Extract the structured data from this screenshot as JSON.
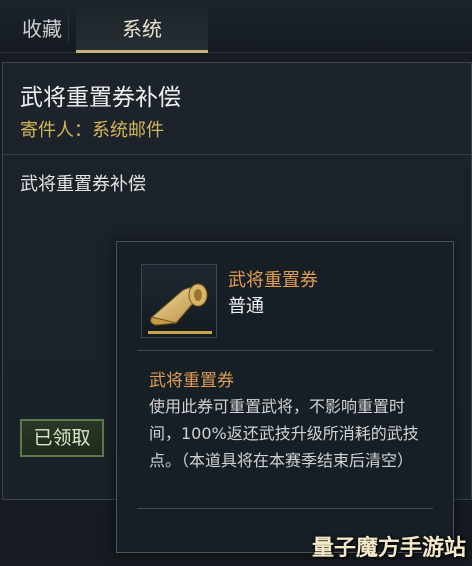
{
  "tabs": {
    "left_partial": "收藏",
    "active": "系统"
  },
  "mail": {
    "title": "武将重置券补偿",
    "sender": "寄件人：系统邮件",
    "body": "武将重置券补偿",
    "claimed_button": "已领取"
  },
  "tooltip": {
    "item_name": "武将重置券",
    "rarity": "普通",
    "desc_title": "武将重置券",
    "desc_text": "使用此券可重置武将，不影响重置时间，100%返还武技升级所消耗的武技点。（本道具将在本赛季结束后清空）",
    "icon": "scroll-icon"
  },
  "watermark": "量子魔方手游站",
  "colors": {
    "accent_gold": "#d4b55a",
    "item_orange": "#e09a52",
    "claimed_green": "#5d7a4c"
  }
}
